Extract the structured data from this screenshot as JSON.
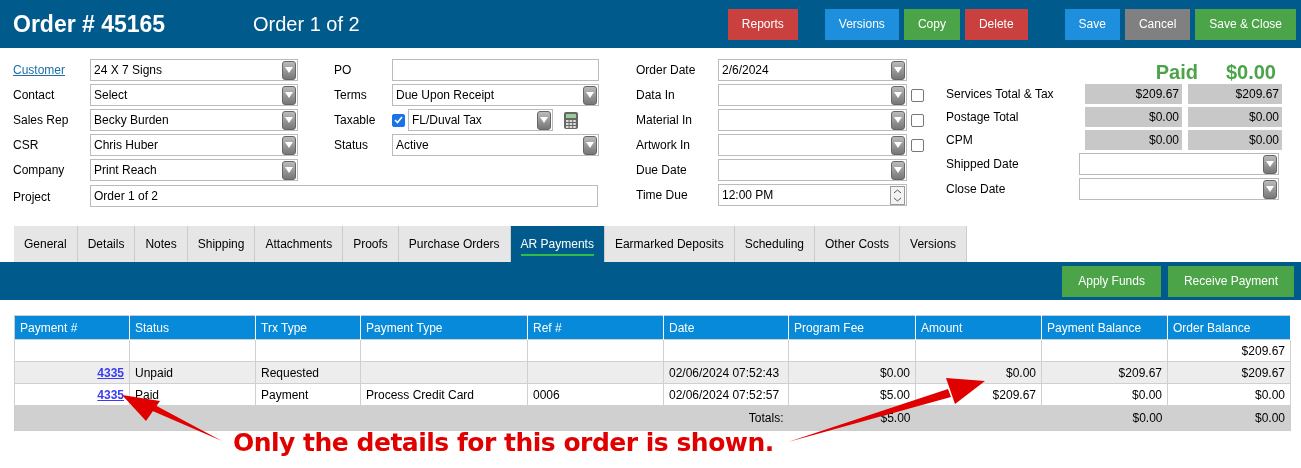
{
  "header": {
    "title": "Order # 45165",
    "subtitle": "Order 1 of 2",
    "buttons": [
      {
        "label": "Reports",
        "kind": "danger"
      },
      {
        "label": "Versions",
        "kind": "primary"
      },
      {
        "label": "Copy",
        "kind": "success"
      },
      {
        "label": "Delete",
        "kind": "danger"
      },
      {
        "label": "Save",
        "kind": "primary"
      },
      {
        "label": "Cancel",
        "kind": "neutral"
      },
      {
        "label": "Save & Close",
        "kind": "success"
      }
    ]
  },
  "form": {
    "column_1": [
      {
        "label": "Customer",
        "link": true,
        "kind": "select",
        "value": "24 X 7 Signs"
      },
      {
        "label": "Contact",
        "link": false,
        "kind": "select",
        "value": "Select"
      },
      {
        "label": "Sales Rep",
        "link": false,
        "kind": "select",
        "value": "Becky Burden"
      },
      {
        "label": "CSR",
        "link": false,
        "kind": "select",
        "value": "Chris Huber"
      },
      {
        "label": "Company",
        "link": false,
        "kind": "select",
        "value": "Print Reach"
      }
    ],
    "column_2": [
      {
        "label": "PO",
        "kind": "text"
      },
      {
        "label": "Terms",
        "kind": "select",
        "value": "Due Upon Receipt"
      },
      {
        "label": "Taxable",
        "kind": "taxable",
        "checked": true,
        "value": "FL/Duval Tax"
      },
      {
        "label": "Status",
        "kind": "select",
        "value": "Active"
      }
    ],
    "project": {
      "label": "Project",
      "value": "Order 1 of 2"
    },
    "column_3": [
      {
        "label": "Order Date",
        "kind": "select",
        "value": "2/6/2024"
      },
      {
        "label": "Data In",
        "kind": "select_check",
        "checked": false
      },
      {
        "label": "Material In",
        "kind": "select_check",
        "checked": false
      },
      {
        "label": "Artwork In",
        "kind": "select_check",
        "checked": false
      },
      {
        "label": "Due Date",
        "kind": "select"
      },
      {
        "label": "Time Due",
        "kind": "spinner",
        "value": "12:00 PM"
      }
    ]
  },
  "summary": {
    "status": "Paid",
    "balance": "$0.00",
    "totals": [
      {
        "label": "Services Total & Tax",
        "values": [
          "$209.67",
          "$209.67"
        ]
      },
      {
        "label": "Postage Total",
        "values": [
          "$0.00",
          "$0.00"
        ]
      },
      {
        "label": "CPM",
        "values": [
          "$0.00",
          "$0.00"
        ]
      }
    ],
    "dates": [
      {
        "label": "Shipped Date"
      },
      {
        "label": "Close Date"
      }
    ]
  },
  "tabs": [
    {
      "label": "General",
      "selected": false
    },
    {
      "label": "Details",
      "selected": false
    },
    {
      "label": "Notes",
      "selected": false
    },
    {
      "label": "Shipping",
      "selected": false
    },
    {
      "label": "Attachments",
      "selected": false
    },
    {
      "label": "Proofs",
      "selected": false
    },
    {
      "label": "Purchase Orders",
      "selected": false
    },
    {
      "label": "AR Payments",
      "selected": true
    },
    {
      "label": "Earmarked Deposits",
      "selected": false
    },
    {
      "label": "Scheduling",
      "selected": false
    },
    {
      "label": "Other Costs",
      "selected": false
    },
    {
      "label": "Versions",
      "selected": false
    }
  ],
  "actions": [
    "Apply Funds",
    "Receive Payment"
  ],
  "table": {
    "columns": [
      "Payment #",
      "Status",
      "Trx Type",
      "Payment Type",
      "Ref #",
      "Date",
      "Program Fee",
      "Amount",
      "Payment Balance",
      "Order Balance"
    ],
    "rows": [
      {
        "order_balance": "$209.67"
      },
      {
        "payment": "4335",
        "status": "Unpaid",
        "trx_type": "Requested",
        "date": "02/06/2024 07:52:43",
        "program_fee": "$0.00",
        "amount": "$0.00",
        "payment_balance": "$209.67",
        "order_balance": "$209.67"
      },
      {
        "payment": "4335",
        "status": "Paid",
        "trx_type": "Payment",
        "payment_type": "Process Credit Card",
        "ref": "0006",
        "date": "02/06/2024 07:52:57",
        "program_fee": "$5.00",
        "amount": "$209.67",
        "payment_balance": "$0.00",
        "order_balance": "$0.00"
      }
    ],
    "totals": {
      "label": "Totals:",
      "program_fee": "$5.00",
      "payment_balance": "$0.00",
      "order_balance": "$0.00"
    }
  },
  "annotation": {
    "text": "Only the details for this order is shown."
  }
}
